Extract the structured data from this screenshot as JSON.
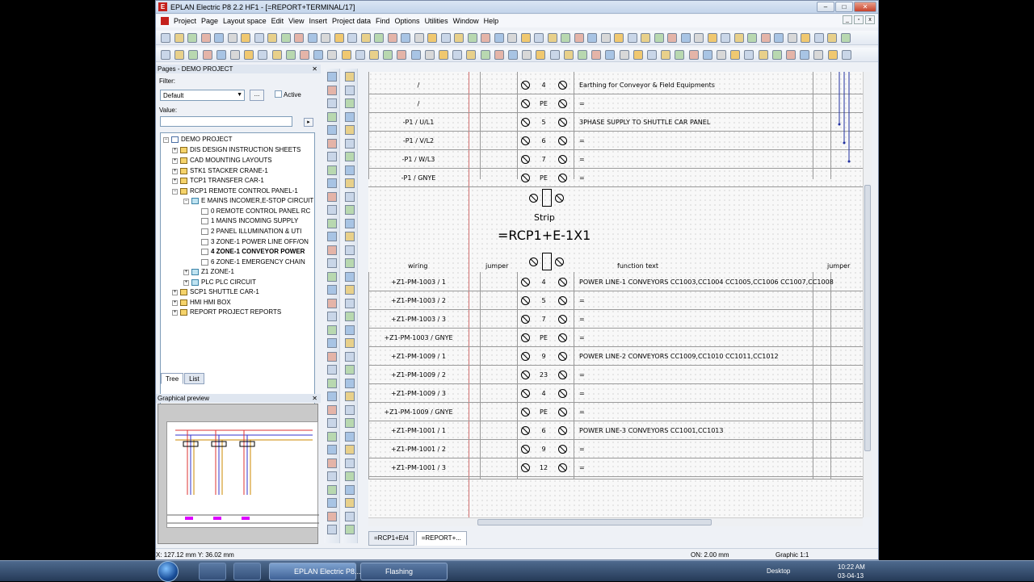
{
  "window": {
    "title": "EPLAN Electric P8 2.2 HF1 - [=REPORT+TERMINAL/17]"
  },
  "menu": [
    "Project",
    "Page",
    "Layout space",
    "Edit",
    "View",
    "Insert",
    "Project data",
    "Find",
    "Options",
    "Utilities",
    "Window",
    "Help"
  ],
  "pages_panel": {
    "title": "Pages - DEMO PROJECT",
    "filter_label": "Filter:",
    "filter_value": "Default",
    "dots_label": "...",
    "active_label": "Active",
    "value_label": "Value:",
    "tree": [
      "DEMO PROJECT",
      "DIS DESIGN INSTRUCTION SHEETS",
      "CAD MOUNTING LAYOUTS",
      "STK1 STACKER CRANE-1",
      "TCP1 TRANSFER CAR-1",
      "RCP1 REMOTE CONTROL PANEL-1",
      "E MAINS INCOMER,E-STOP CIRCUIT",
      "0 REMOTE CONTROL PANEL RC",
      "1 MAINS INCOMING SUPPLY",
      "2 PANEL ILLUMINATION & UTI",
      "3 ZONE-1 POWER LINE OFF/ON",
      "4 ZONE-1 CONVEYOR POWER",
      "6 ZONE-1 EMERGENCY CHAIN",
      "Z1 ZONE-1",
      "PLC PLC CIRCUIT",
      "SCP1 SHUTTLE CAR-1",
      "HMI HMI BOX",
      "REPORT PROJECT REPORTS"
    ],
    "tabs": [
      "Tree",
      "List"
    ]
  },
  "preview_panel": {
    "title": "Graphical preview"
  },
  "drawing": {
    "top_rows": [
      {
        "wiring": "/",
        "num": "4",
        "text": "Earthing for Conveyor & Field Equipments"
      },
      {
        "wiring": "/",
        "num": "PE",
        "text": "="
      },
      {
        "wiring": "-P1 / U/L1",
        "num": "5",
        "text": "3PHASE SUPPLY TO SHUTTLE CAR PANEL"
      },
      {
        "wiring": "-P1 / V/L2",
        "num": "6",
        "text": "="
      },
      {
        "wiring": "-P1 / W/L3",
        "num": "7",
        "text": "="
      },
      {
        "wiring": "-P1 / GNYE",
        "num": "PE",
        "text": "="
      }
    ],
    "strip_label": "Strip",
    "strip_name": "=RCP1+E-1X1",
    "headers": {
      "wiring": "wiring",
      "jumper": "jumper",
      "function_text": "function text",
      "jumper2": "jumper"
    },
    "bottom_rows": [
      {
        "wiring": "+Z1-PM-1003 / 1",
        "num": "4",
        "text": "POWER LINE-1 CONVEYORS CC1003,CC1004 CC1005,CC1006 CC1007,CC1008"
      },
      {
        "wiring": "+Z1-PM-1003 / 2",
        "num": "5",
        "text": "="
      },
      {
        "wiring": "+Z1-PM-1003 / 3",
        "num": "7",
        "text": "="
      },
      {
        "wiring": "+Z1-PM-1003 / GNYE",
        "num": "PE",
        "text": "="
      },
      {
        "wiring": "+Z1-PM-1009 / 1",
        "num": "9",
        "text": "POWER LINE-2 CONVEYORS CC1009,CC1010 CC1011,CC1012"
      },
      {
        "wiring": "+Z1-PM-1009 / 2",
        "num": "23",
        "text": "="
      },
      {
        "wiring": "+Z1-PM-1009 / 3",
        "num": "4",
        "text": "="
      },
      {
        "wiring": "+Z1-PM-1009 / GNYE",
        "num": "PE",
        "text": "="
      },
      {
        "wiring": "+Z1-PM-1001 / 1",
        "num": "6",
        "text": "POWER LINE-3 CONVEYORS CC1001,CC1013"
      },
      {
        "wiring": "+Z1-PM-1001 / 2",
        "num": "9",
        "text": "="
      },
      {
        "wiring": "+Z1-PM-1001 / 3",
        "num": "12",
        "text": "="
      }
    ]
  },
  "sheet_tabs": [
    "=RCP1+E/4",
    "=REPORT+..."
  ],
  "status": {
    "coords": "X: 127.12 mm    Y: 36.02 mm",
    "on": "ON: 2.00 mm",
    "scale": "Graphic 1:1"
  },
  "taskbar": {
    "tasks": [
      "EPLAN Electric P8...",
      "Flashing"
    ],
    "desktop": "Desktop",
    "time": "10:22 AM",
    "date": "03-04-13"
  },
  "colors": {
    "accent": "#c4201c",
    "grid_line": "#d07070",
    "desktop": "#000000"
  }
}
